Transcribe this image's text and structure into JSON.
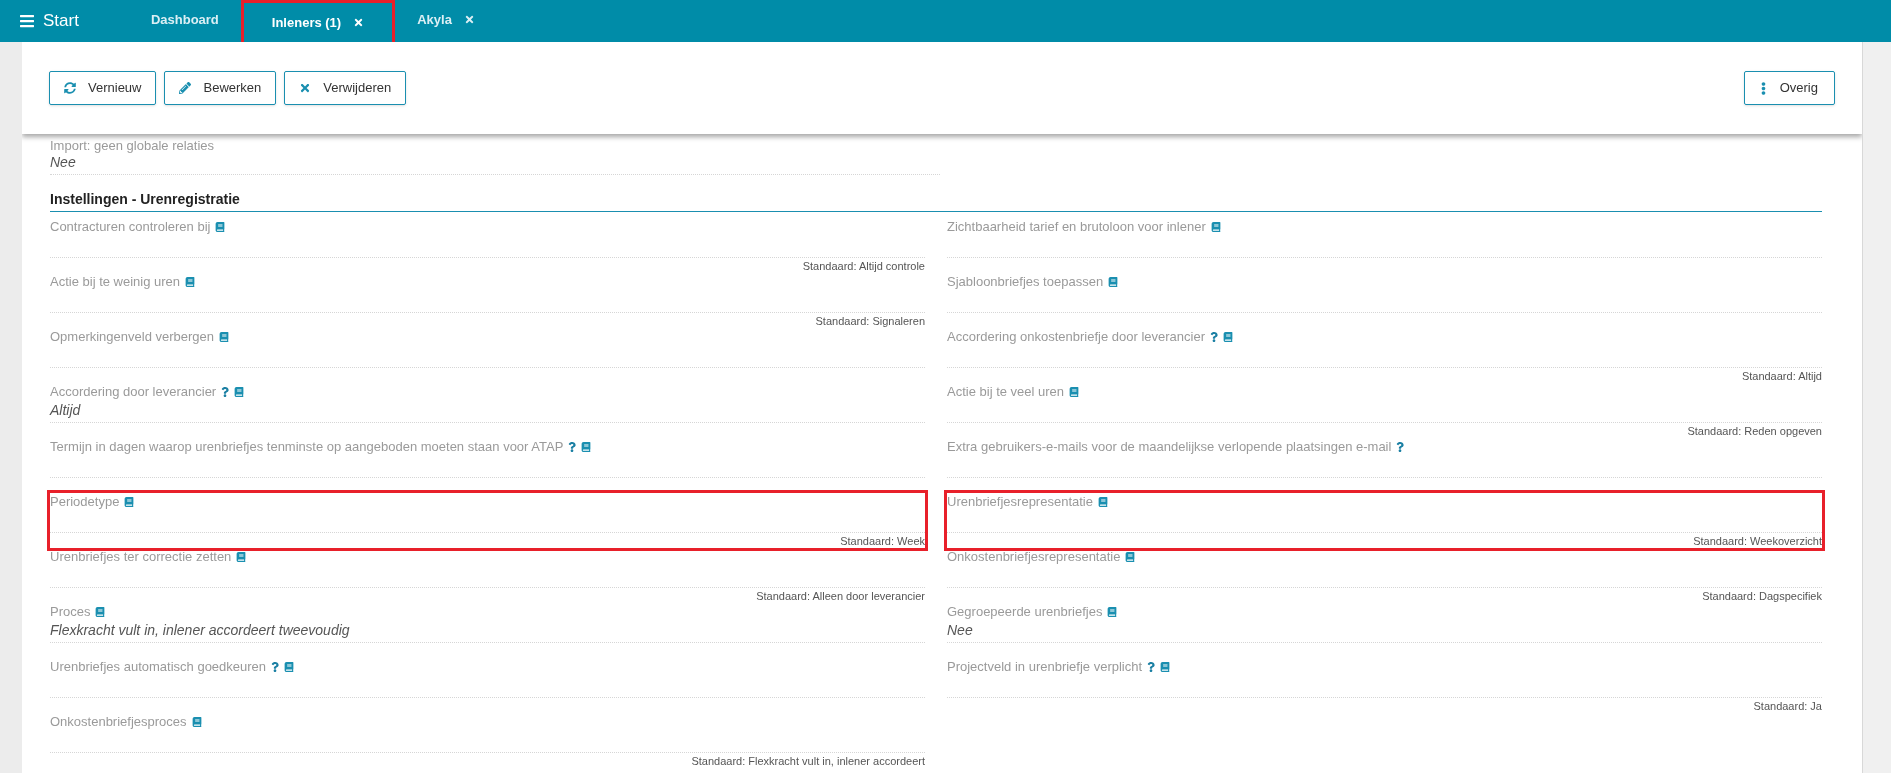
{
  "header": {
    "menu_label": "Start",
    "tabs": [
      {
        "label": "Dashboard",
        "selected": false,
        "closable": false,
        "highlighted": false
      },
      {
        "label": "Inleners (1)",
        "selected": true,
        "closable": true,
        "highlighted": true
      },
      {
        "label": "Akyla",
        "selected": false,
        "closable": true,
        "highlighted": false
      }
    ]
  },
  "toolbar": {
    "buttons": [
      {
        "label": "Vernieuw"
      },
      {
        "label": "Bewerken"
      },
      {
        "label": "Verwijderen"
      }
    ],
    "overflow_button": {
      "label": "Overig"
    }
  },
  "fields_above": [
    {
      "label": "Import: geen globale relaties",
      "value": "Nee"
    }
  ],
  "section": {
    "title": "Instellingen - Urenregistratie",
    "left": [
      {
        "label": "Contracturen controleren bij",
        "help": false,
        "info": true,
        "default": "Standaard: Altijd controle",
        "highlighted": false
      },
      {
        "label": "Actie bij te weinig uren",
        "help": false,
        "info": true,
        "default": "Standaard: Signaleren",
        "highlighted": false
      },
      {
        "label": "Opmerkingenveld verbergen",
        "help": false,
        "info": true,
        "highlighted": false
      },
      {
        "label": "Accordering door leverancier",
        "help": true,
        "info": true,
        "value": "Altijd",
        "highlighted": false
      },
      {
        "label": "Termijn in dagen waarop urenbriefjes tenminste op aangeboden moeten staan voor ATAP",
        "help": true,
        "info": true,
        "highlighted": false
      },
      {
        "label": "Periodetype",
        "help": false,
        "info": true,
        "default": "Standaard: Week",
        "highlighted": true
      },
      {
        "label": "Urenbriefjes ter correctie zetten",
        "help": false,
        "info": true,
        "default": "Standaard: Alleen door leverancier",
        "highlighted": false
      },
      {
        "label": "Proces",
        "help": false,
        "info": true,
        "value": "Flexkracht vult in, inlener accordeert tweevoudig",
        "highlighted": false
      },
      {
        "label": "Urenbriefjes automatisch goedkeuren",
        "help": true,
        "info": true,
        "highlighted": false
      },
      {
        "label": "Onkostenbriefjesproces",
        "help": false,
        "info": true,
        "default": "Standaard: Flexkracht vult in, inlener accordeert",
        "highlighted": false
      }
    ],
    "right": [
      {
        "label": "Zichtbaarheid tarief en brutoloon voor inlener",
        "help": false,
        "info": true,
        "highlighted": false
      },
      {
        "label": "Sjabloonbriefjes toepassen",
        "help": false,
        "info": true,
        "highlighted": false
      },
      {
        "label": "Accordering onkostenbriefje door leverancier",
        "help": true,
        "info": true,
        "default": "Standaard: Altijd",
        "highlighted": false
      },
      {
        "label": "Actie bij te veel uren",
        "help": false,
        "info": true,
        "default": "Standaard: Reden opgeven",
        "highlighted": false
      },
      {
        "label": "Extra gebruikers-e-mails voor de maandelijkse verlopende plaatsingen e-mail",
        "help": true,
        "info": false,
        "highlighted": false
      },
      {
        "label": "Urenbriefjesrepresentatie",
        "help": false,
        "info": true,
        "default": "Standaard: Weekoverzicht",
        "highlighted": true
      },
      {
        "label": "Onkostenbriefjesrepresentatie",
        "help": false,
        "info": true,
        "default": "Standaard: Dagspecifiek",
        "highlighted": false
      },
      {
        "label": "Gegroepeerde urenbriefjes",
        "help": false,
        "info": true,
        "value": "Nee",
        "highlighted": false
      },
      {
        "label": "Projectveld in urenbriefje verplicht",
        "help": true,
        "info": true,
        "default": "Standaard: Ja",
        "highlighted": false
      }
    ]
  }
}
